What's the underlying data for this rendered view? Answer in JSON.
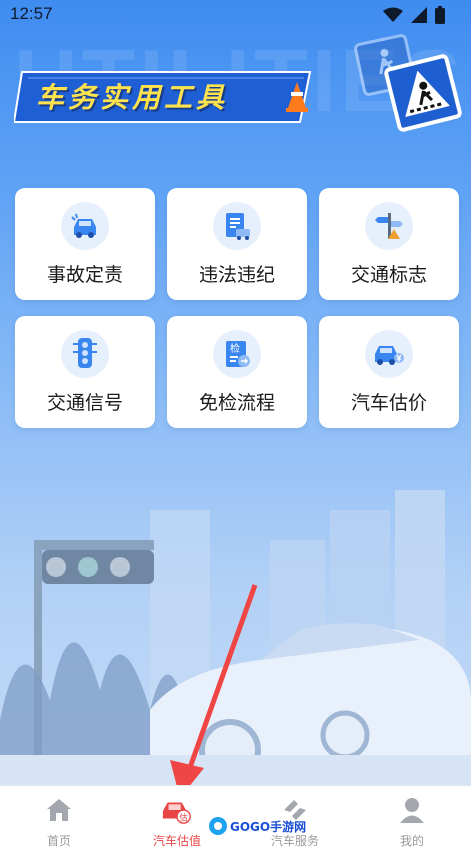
{
  "status": {
    "time": "12:57"
  },
  "header": {
    "background_text": "UTILITIES",
    "title": "车务实用工具"
  },
  "tools": [
    {
      "label": "事故定责",
      "icon": "car-accident-icon"
    },
    {
      "label": "违法违纪",
      "icon": "document-car-icon"
    },
    {
      "label": "交通标志",
      "icon": "road-sign-icon"
    },
    {
      "label": "交通信号",
      "icon": "traffic-light-icon"
    },
    {
      "label": "免检流程",
      "icon": "inspection-doc-icon"
    },
    {
      "label": "汽车估价",
      "icon": "car-yen-icon"
    }
  ],
  "tabs": [
    {
      "label": "首页",
      "icon": "home-icon",
      "active": false
    },
    {
      "label": "汽车估值",
      "icon": "car-valuation-icon",
      "active": true,
      "badge": "估"
    },
    {
      "label": "汽车服务",
      "icon": "service-icon",
      "active": false
    },
    {
      "label": "我的",
      "icon": "profile-icon",
      "active": false
    }
  ],
  "watermark": {
    "text": "GOGO手游网"
  },
  "colors": {
    "accent": "#e84545",
    "primary": "#1d5fd1",
    "title": "#ffe34d"
  }
}
